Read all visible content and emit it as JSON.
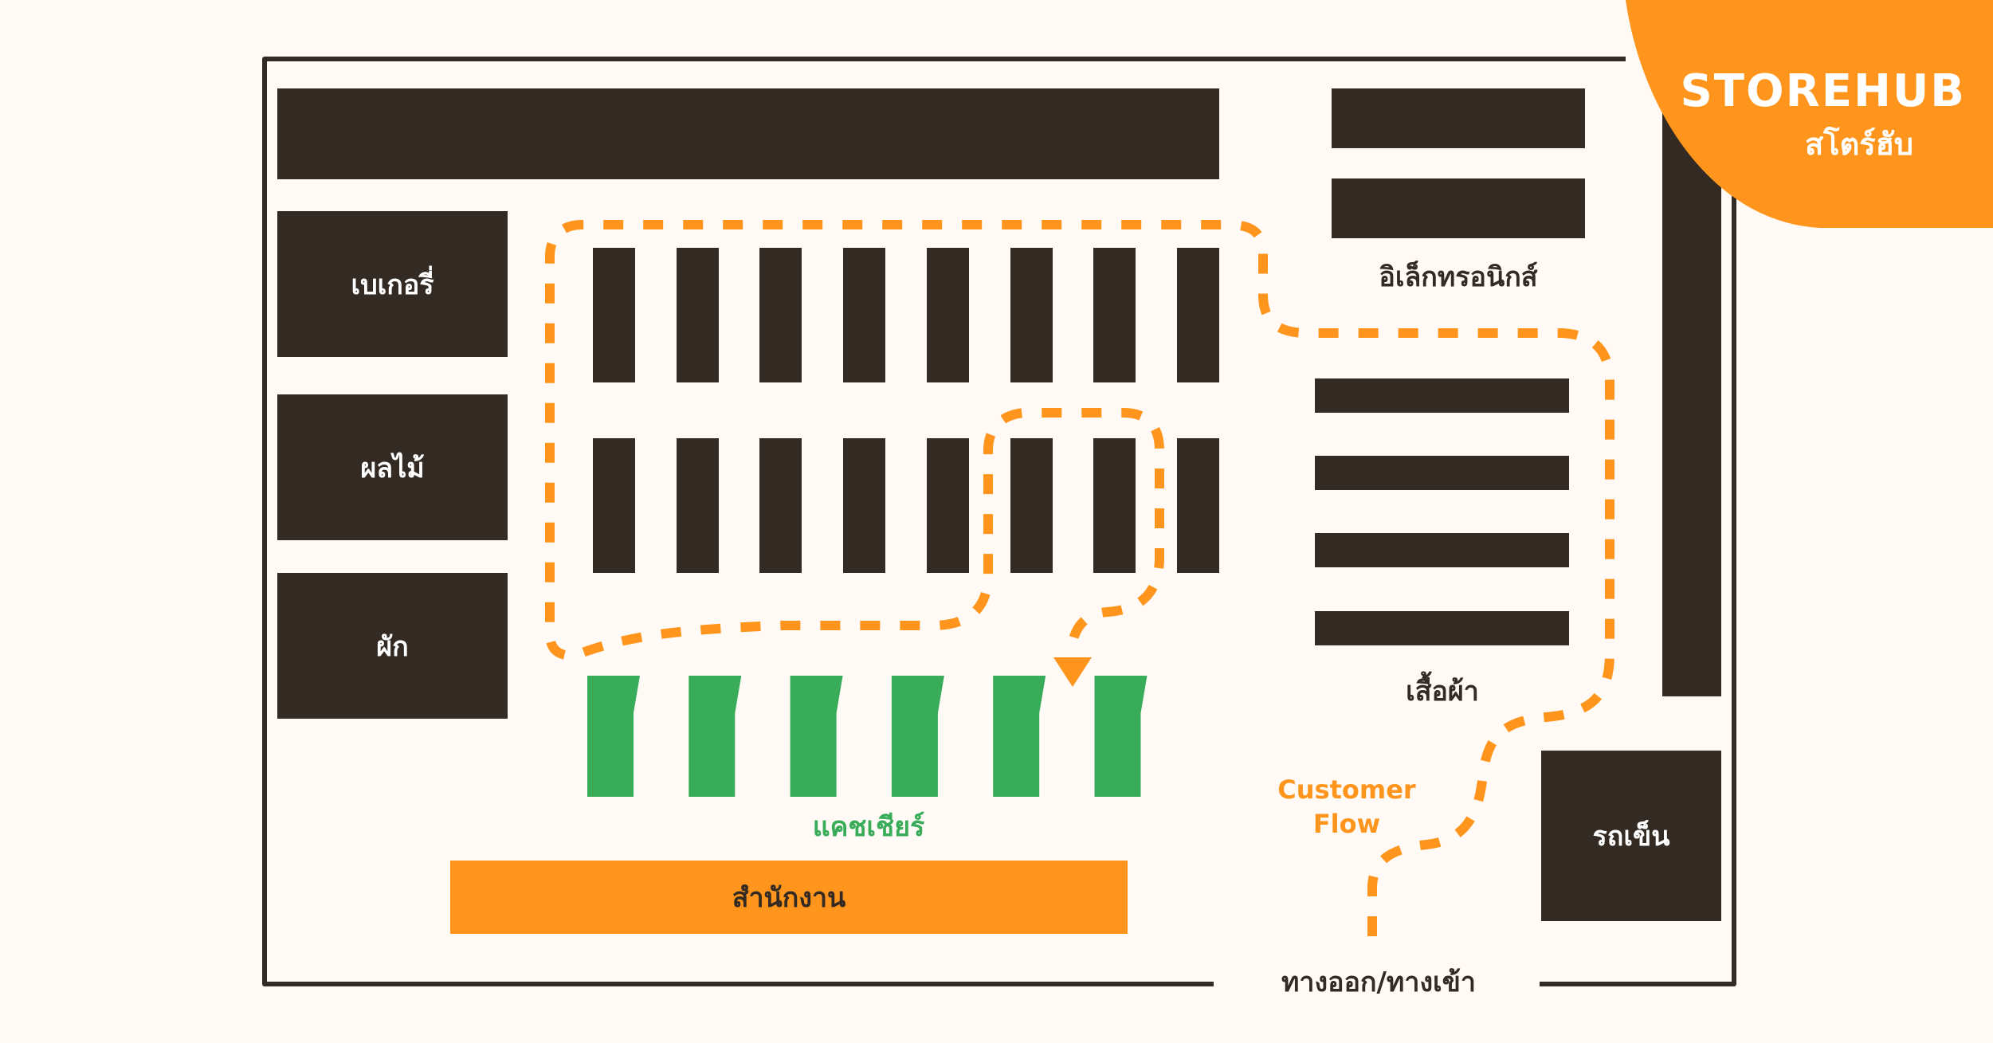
{
  "brand": {
    "name": "STOREHUB",
    "name_thai": "สโตร์ฮับ",
    "accent_color": "#FF951C"
  },
  "colors": {
    "background": "#FFFAF5",
    "shelf": "#322A23",
    "cashier": "#39AC5A",
    "flow": "#FF951C"
  },
  "sections": {
    "bakery": "เบเกอรี่",
    "fruit": "ผลไม้",
    "vegetables": "ผัก",
    "electronics": "อิเล็กทรอนิกส์",
    "clothing": "เสื้อผ้า",
    "carts": "รถเข็น",
    "cashier": "แคชเชียร์",
    "office": "สำนักงาน",
    "entrance": "ทางออก/ทางเข้า"
  },
  "flow": {
    "label_line1": "Customer",
    "label_line2": "Flow"
  },
  "counts": {
    "aisle_shelves_top_row": 8,
    "aisle_shelves_bottom_row": 8,
    "cashier_counters": 6,
    "electronics_shelves": 2,
    "clothing_racks": 4
  }
}
